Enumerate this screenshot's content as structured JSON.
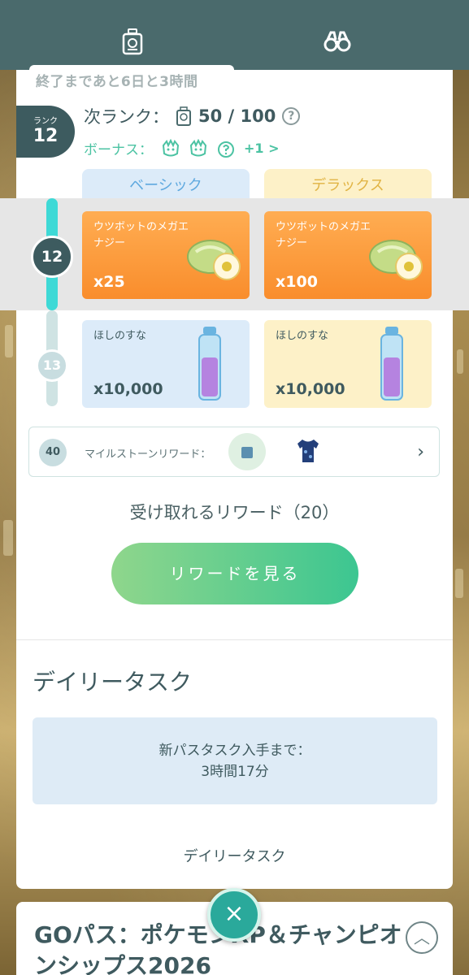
{
  "header": {
    "left_icon": "pass-badge-icon",
    "right_icon": "binoculars-icon"
  },
  "pass": {
    "time_remaining": "終了まであと6日と3時間",
    "rank_label": "ランク",
    "rank_value": "12",
    "next_rank_label": "次ランク：",
    "next_rank_progress": "50 / 100",
    "help": "?",
    "bonus_label": "ボーナス：",
    "bonus_more": "+1 >"
  },
  "tiers": {
    "basic": "ベーシック",
    "deluxe": "デラックス"
  },
  "rows": [
    {
      "rank": "12",
      "basic": {
        "name": "ウツボットのメガエナジー",
        "qty": "x25"
      },
      "deluxe": {
        "name": "ウツボットのメガエナジー",
        "qty": "x100"
      }
    },
    {
      "rank": "13",
      "basic": {
        "name": "ほしのすな",
        "qty": "x10,000"
      },
      "deluxe": {
        "name": "ほしのすな",
        "qty": "x10,000"
      }
    }
  ],
  "milestone": {
    "rank": "40",
    "label": "マイルストーンリワード："
  },
  "claimable": "受け取れるリワード（20）",
  "view_button": "リワードを見る",
  "daily": {
    "title": "デイリータスク",
    "next_task_label": "新パスタスク入手まで：",
    "next_task_time": "3時間17分",
    "link": "デイリータスク"
  },
  "next_card": {
    "title": "GOパス：ポケモンXP＆チャンピオンシップス2026"
  },
  "close": "×",
  "colors": {
    "accent": "#3cc691",
    "header": "#4a6a6c",
    "orange": "#f98d2c"
  }
}
